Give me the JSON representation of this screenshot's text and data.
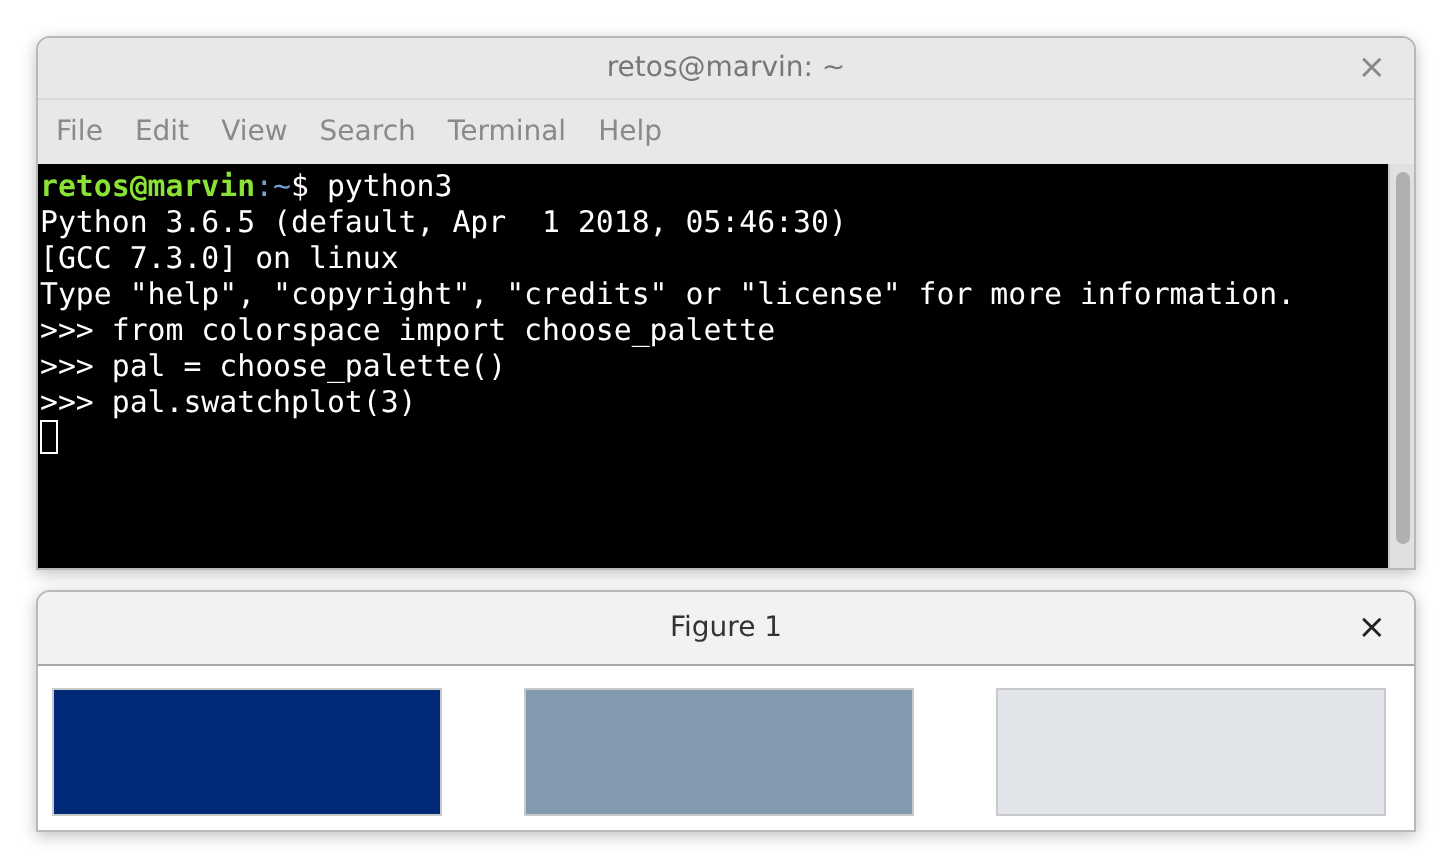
{
  "terminal_window": {
    "title": "retos@marvin: ~",
    "menu": [
      "File",
      "Edit",
      "View",
      "Search",
      "Terminal",
      "Help"
    ],
    "lines": [
      {
        "kind": "prompt",
        "user_host": "retos@marvin",
        "path": ":~",
        "symbol": "$",
        "command": " python3"
      },
      {
        "kind": "output",
        "text": "Python 3.6.5 (default, Apr  1 2018, 05:46:30)"
      },
      {
        "kind": "output",
        "text": "[GCC 7.3.0] on linux"
      },
      {
        "kind": "output",
        "text": "Type \"help\", \"copyright\", \"credits\" or \"license\" for more information."
      },
      {
        "kind": "output",
        "text": ">>> from colorspace import choose_palette"
      },
      {
        "kind": "output",
        "text": ">>> pal = choose_palette()"
      },
      {
        "kind": "output",
        "text": ">>> pal.swatchplot(3)"
      },
      {
        "kind": "cursor"
      }
    ],
    "close": "×"
  },
  "figure_window": {
    "title": "Figure 1",
    "close": "×",
    "swatches": [
      {
        "color": "#002a77"
      },
      {
        "color": "#8399b0"
      },
      {
        "color": "#e1e5ea"
      }
    ]
  }
}
